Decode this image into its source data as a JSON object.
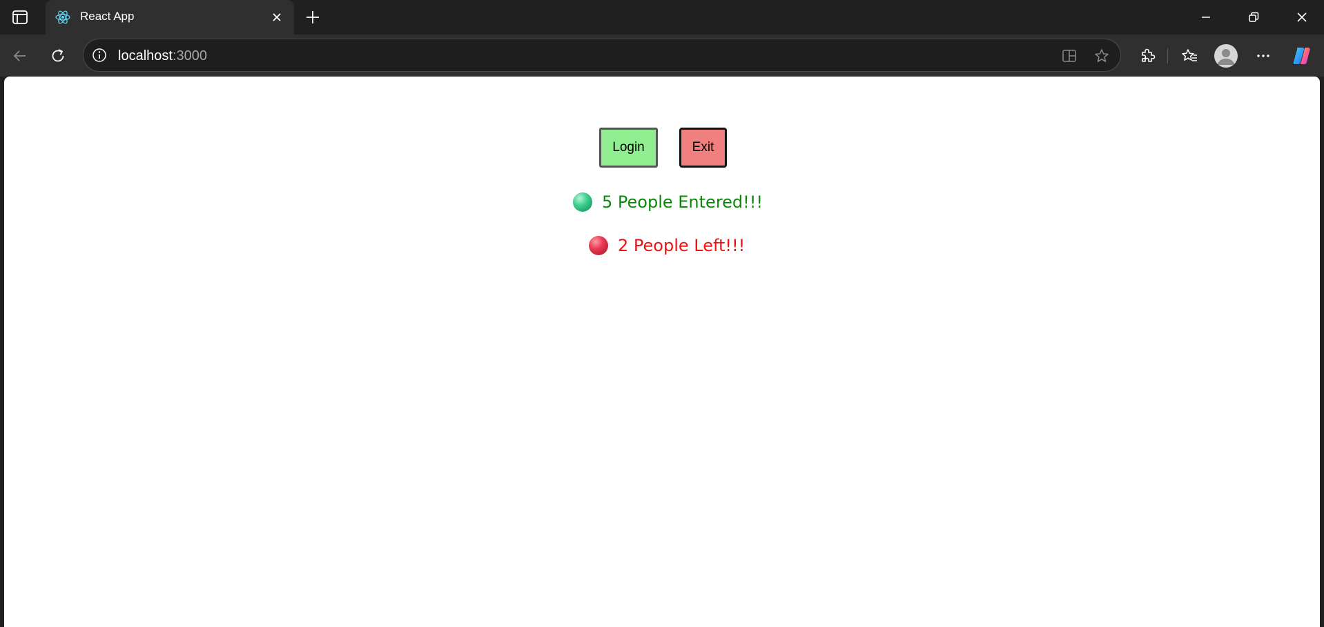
{
  "browser": {
    "tab_title": "React App",
    "url_host": "localhost",
    "url_port": ":3000"
  },
  "page": {
    "login_label": "Login",
    "exit_label": "Exit",
    "entered_text": "5 People Entered!!!",
    "left_text": "2 People Left!!!"
  },
  "colors": {
    "login_bg": "#90ee90",
    "exit_bg": "#f08080",
    "entered_color": "#0a8a0a",
    "left_color": "#ee1111"
  },
  "icons": {
    "sidebar": "tab-sidebar-icon",
    "favicon": "react-logo-icon",
    "close": "close-icon",
    "new_tab": "plus-icon",
    "back": "back-arrow-icon",
    "refresh": "refresh-icon",
    "site_info": "info-icon",
    "split": "split-screen-icon",
    "favorite": "star-icon",
    "extensions": "puzzle-icon",
    "favorites": "favorites-icon",
    "profile": "profile-icon",
    "more": "more-icon",
    "copilot": "copilot-icon",
    "entered": "green-ball-icon",
    "left": "red-ball-icon"
  }
}
